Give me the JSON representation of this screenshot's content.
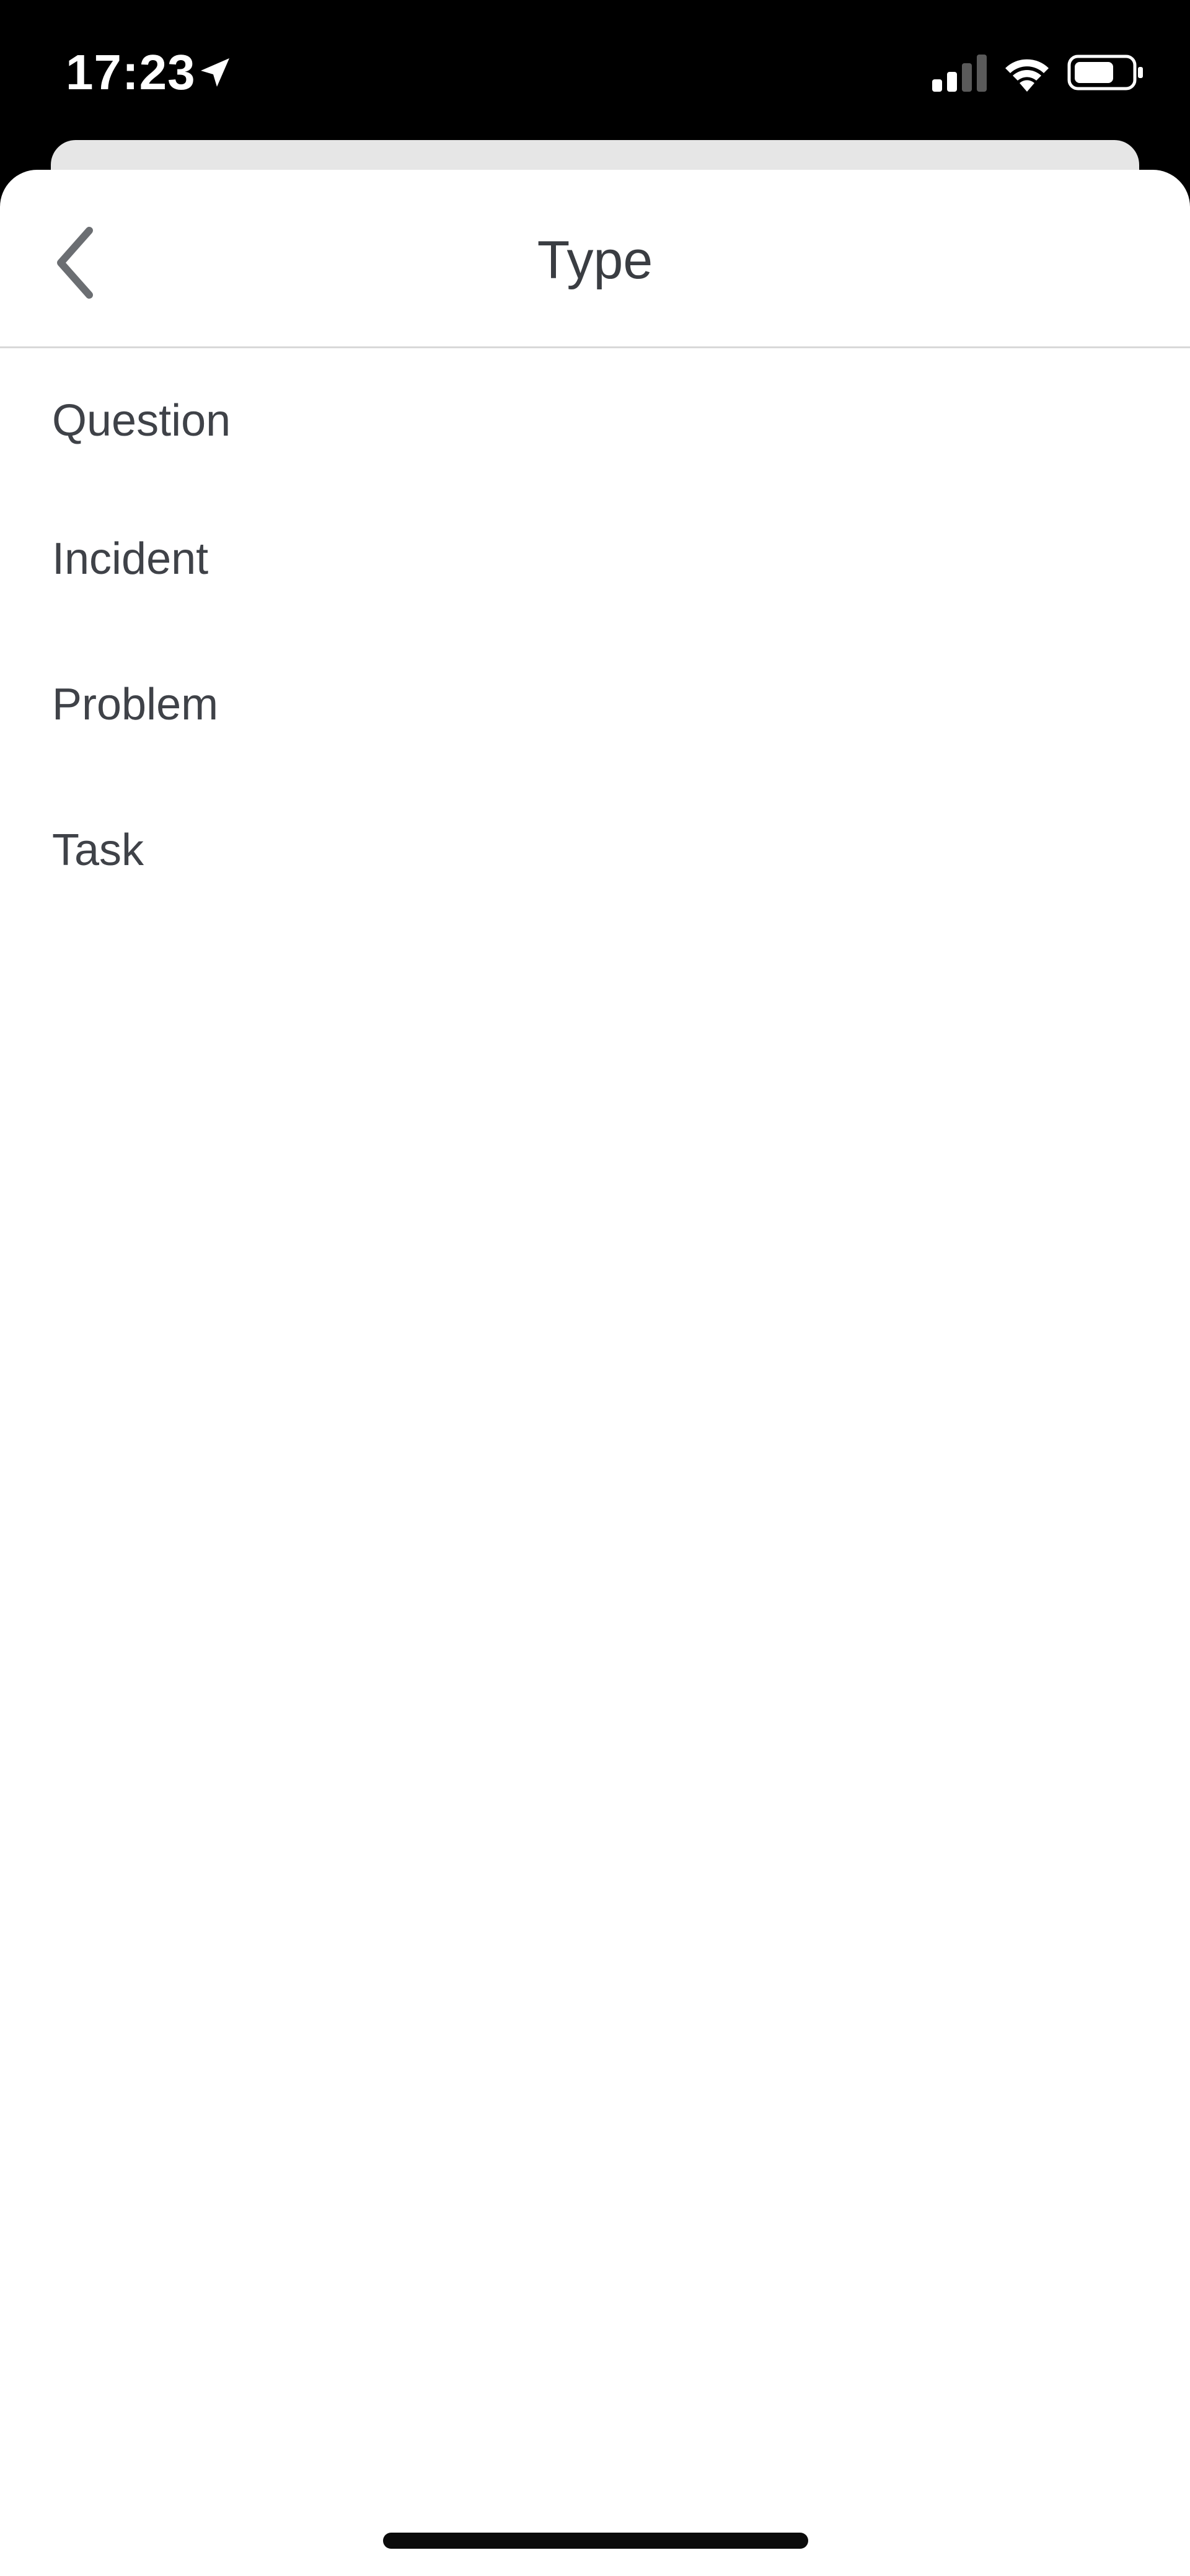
{
  "status_bar": {
    "time": "17:23",
    "icons": [
      "location-arrow-icon",
      "cellular-signal-icon",
      "wifi-icon",
      "battery-icon"
    ]
  },
  "header": {
    "title": "Type",
    "back_icon": "chevron-left-icon"
  },
  "type_options": [
    {
      "label": "Question"
    },
    {
      "label": "Incident"
    },
    {
      "label": "Problem"
    },
    {
      "label": "Task"
    }
  ],
  "colors": {
    "status_bar_bg": "#000000",
    "sheet_bg": "#ffffff",
    "text": "#3f4248",
    "divider": "#d8d8d8",
    "back_card": "#e6e6e6",
    "icon": "#6b6e72"
  }
}
